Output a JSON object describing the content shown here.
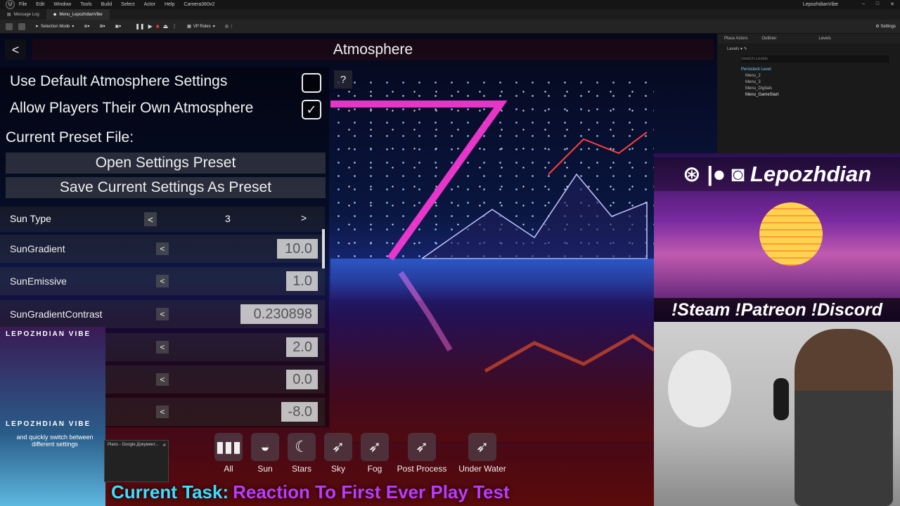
{
  "menubar": {
    "items": [
      "File",
      "Edit",
      "Window",
      "Tools",
      "Build",
      "Select",
      "Actor",
      "Help",
      "Camera360v2"
    ],
    "user": "LepozhdianVibe"
  },
  "tabs": [
    {
      "label": "Message Log"
    },
    {
      "label": "Menu_LepozhdianVibe"
    }
  ],
  "toolbar": {
    "selection_mode": "Selection Mode",
    "vp_roles": "VP Roles",
    "settings": "Settings"
  },
  "atmosphere": {
    "back": "<",
    "title": "Atmosphere",
    "help": "?",
    "use_default_label": "Use Default Atmosphere Settings",
    "use_default_checked": false,
    "allow_players_label": "Allow Players Their Own Atmosphere",
    "allow_players_checked": true,
    "check_mark": "✓",
    "preset_label": "Current Preset File:",
    "open_preset": "Open Settings Preset",
    "save_preset": "Save Current Settings As Preset",
    "sun_type": {
      "label": "Sun Type",
      "prev": "<",
      "value": "3",
      "next": ">"
    },
    "properties": [
      {
        "label": "SunGradient",
        "arrow": "<",
        "value": "10.0"
      },
      {
        "label": "SunEmissive",
        "arrow": "<",
        "value": "1.0"
      },
      {
        "label": "SunGradientContrast",
        "arrow": "<",
        "value": "0.230898"
      },
      {
        "label": "",
        "arrow": "<",
        "value": "2.0"
      },
      {
        "label": "",
        "arrow": "<",
        "value": "0.0"
      },
      {
        "label": "",
        "arrow": "<",
        "value": "-8.0"
      }
    ]
  },
  "categories": [
    {
      "label": "All",
      "icon": "bars-icon"
    },
    {
      "label": "Sun",
      "icon": "sun-icon"
    },
    {
      "label": "Stars",
      "icon": "moon-stars-icon"
    },
    {
      "label": "Sky",
      "icon": "bird-icon"
    },
    {
      "label": "Fog",
      "icon": "bird-icon"
    },
    {
      "label": "Post Process",
      "icon": "bird-icon"
    },
    {
      "label": "Under Water",
      "icon": "bird-icon"
    }
  ],
  "overlay": {
    "logo_top": "LEPOZHDIAN VIBE",
    "logo_bottom": "LEPOZHDIAN VIBE",
    "tagline": "and quickly switch between different settings",
    "notif_title": "Plans - Google Документ...",
    "notif_close": "×",
    "task_prefix": "Current Task:",
    "task_text": "Reaction To First Ever Play Test"
  },
  "levels": {
    "tabs": [
      "Place Actors",
      "Outliner",
      "Levels"
    ],
    "dropdown": "Levels",
    "search_placeholder": "Search Levels",
    "items": [
      "Persistent Level",
      "Menu_2",
      "Menu_3",
      "Menu_Digitals",
      "Menu_GameStart"
    ]
  },
  "social": {
    "name": "Lepozhdian",
    "links": "!Steam !Patreon !Discord"
  },
  "colors": {
    "task_prefix": "#38e0ff",
    "task_text": "#c238ff",
    "neon_pink": "#ff3ad8"
  }
}
